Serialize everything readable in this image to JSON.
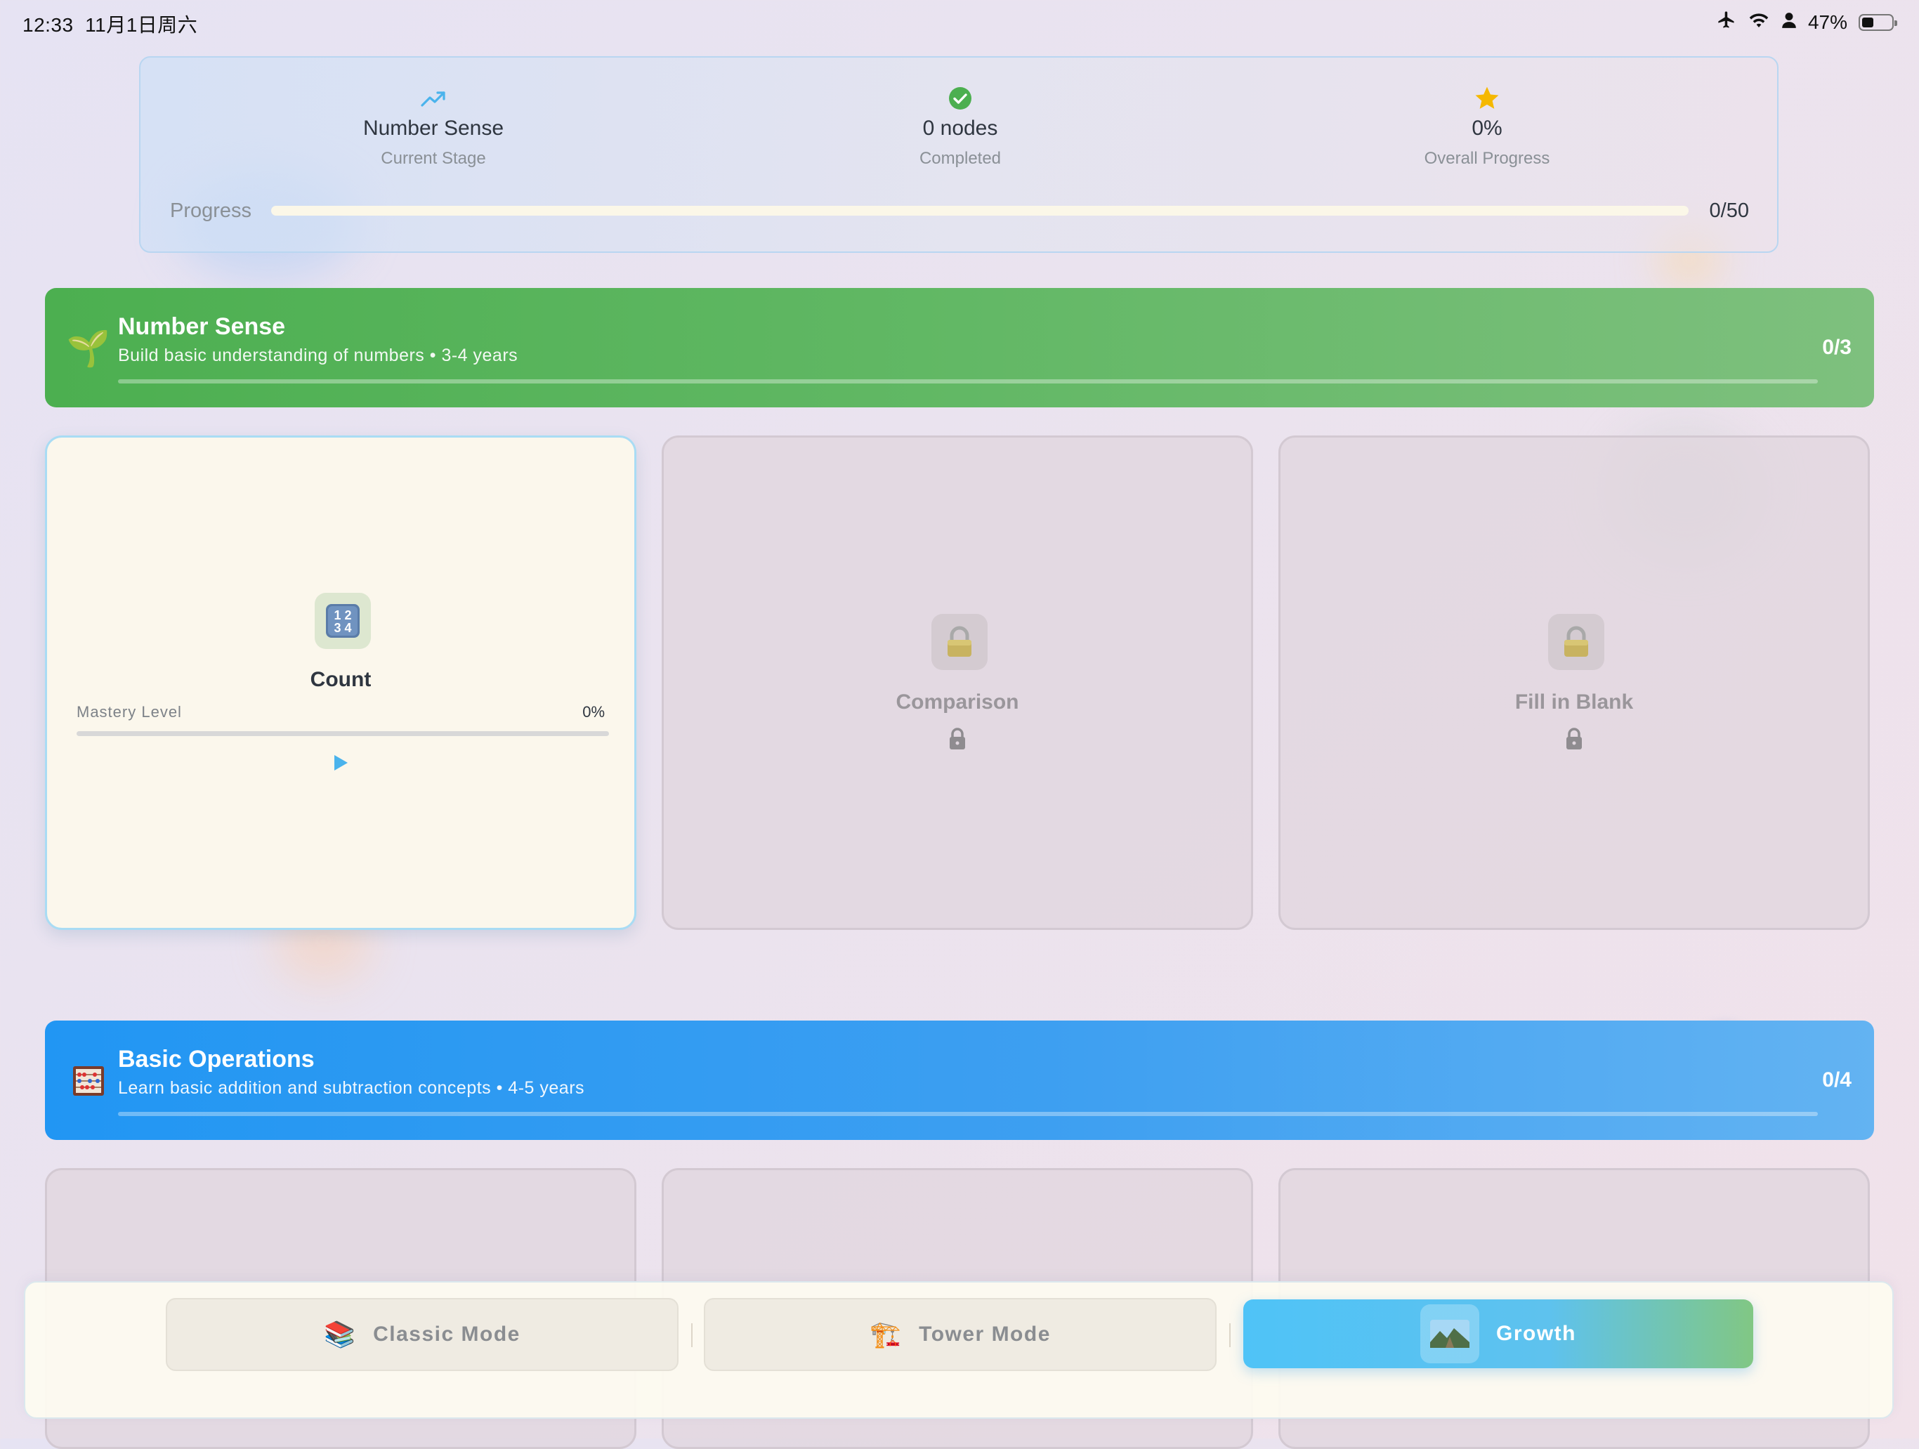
{
  "status_bar": {
    "time": "12:33",
    "date": "11月1日周六",
    "battery": "47%",
    "battery_level": 0.47,
    "icons": [
      "airplane-icon",
      "wifi-icon",
      "person-icon",
      "battery-icon"
    ]
  },
  "summary": {
    "stage": {
      "value": "Number Sense",
      "label": "Current Stage",
      "icon": "trend-up-icon",
      "color": "#4ab3ec"
    },
    "completed": {
      "value": "0 nodes",
      "label": "Completed",
      "icon": "check-circle-icon",
      "color": "#4caf50"
    },
    "overall": {
      "value": "0%",
      "label": "Overall Progress",
      "icon": "star-icon",
      "color": "#f5b800"
    },
    "progress_label": "Progress",
    "progress_count": "0/50",
    "progress_fraction": 0.0
  },
  "stages": [
    {
      "title": "Number Sense",
      "subtitle": "Build basic understanding of numbers • 3-4 years",
      "count": "0/3",
      "fraction": 0.0,
      "icon": "🌱",
      "icon_name": "seedling-icon",
      "color": "#4caf50",
      "nodes": [
        {
          "title": "Count",
          "icon": "🔢",
          "icon_name": "numbers-icon",
          "locked": false,
          "mastery_label": "Mastery Level",
          "mastery_value": "0%",
          "mastery_fraction": 0.0
        },
        {
          "title": "Comparison",
          "icon": "🔒",
          "icon_name": "padlock-icon",
          "locked": true
        },
        {
          "title": "Fill in Blank",
          "icon": "🔒",
          "icon_name": "padlock-icon",
          "locked": true
        }
      ]
    },
    {
      "title": "Basic Operations",
      "subtitle": "Learn basic addition and subtraction concepts • 4-5 years",
      "count": "0/4",
      "fraction": 0.0,
      "icon": "🧮",
      "icon_name": "abacus-icon",
      "color": "#2196f3"
    }
  ],
  "modes": [
    {
      "label": "Classic Mode",
      "icon": "📚",
      "icon_name": "books-icon",
      "active": false
    },
    {
      "label": "Tower Mode",
      "icon": "🏗️",
      "icon_name": "crane-icon",
      "active": false
    },
    {
      "label": "Growth",
      "icon": "🏞️",
      "icon_name": "landscape-icon",
      "active": true
    }
  ],
  "accent": "#4fc3f7"
}
